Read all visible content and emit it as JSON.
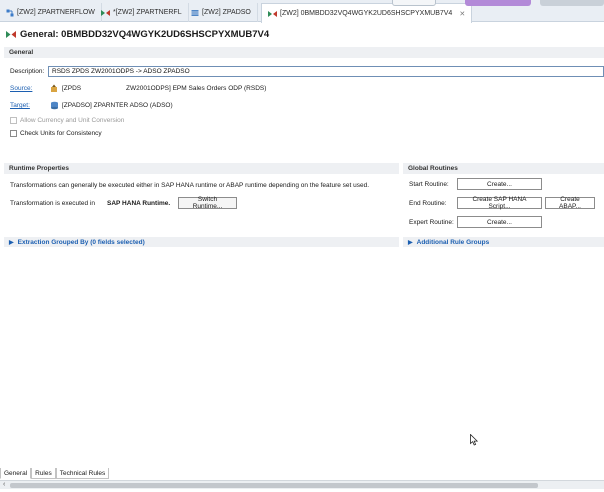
{
  "tabs": [
    {
      "label": "[ZW2] ZPARTNERFLOW",
      "icon": "dataflow-icon"
    },
    {
      "label": "*[ZW2] ZPARTNERFL",
      "icon": "transformation-icon"
    },
    {
      "label": "[ZW2] ZPADSO",
      "icon": "adso-icon"
    },
    {
      "label": "[ZW2] 0BMBDD32VQ4WGYK2UD6SHSCPYXMUB7V4",
      "icon": "transformation-icon",
      "active": true
    }
  ],
  "title": "General: 0BMBDD32VQ4WGYK2UD6SHSCPYXMUB7V4",
  "general": {
    "header": "General",
    "description_label": "Description:",
    "description_value": "RSDS ZPDS ZW2001ODPS -> ADSO ZPADSO",
    "source_label": "Source:",
    "source_name": "[ZPDS",
    "source_desc": "ZW2001ODPS] EPM Sales Orders ODP (RSDS)",
    "target_label": "Target:",
    "target_value": "[ZPADSO] ZPARNTER ADSO (ADSO)",
    "allow_currency": "Allow Currency and Unit Conversion",
    "check_units": "Check Units for Consistency"
  },
  "runtime": {
    "header": "Runtime Properties",
    "info": "Transformations can generally be executed either in SAP HANA runtime or ABAP runtime depending on the feature set used.",
    "executed_label": "Transformation is executed in",
    "executed_value": "SAP HANA Runtime.",
    "switch_button": "Switch Runtime..."
  },
  "global_routines": {
    "header": "Global Routines",
    "start_label": "Start Routine:",
    "start_button": "Create...",
    "end_label": "End Routine:",
    "end_hana_button": "Create SAP HANA Script...",
    "end_abap_button": "Create ABAP...",
    "expert_label": "Expert Routine:",
    "expert_button": "Create..."
  },
  "extraction_group": "Extraction Grouped By (0 fields selected)",
  "additional_rule_groups": "Additional Rule Groups",
  "bottom_tabs": [
    "General",
    "Rules",
    "Technical Rules"
  ],
  "colors": {
    "link": "#1c5fb1",
    "section_bg": "#eef0f3",
    "modeling_badge": "#b38ad8"
  }
}
